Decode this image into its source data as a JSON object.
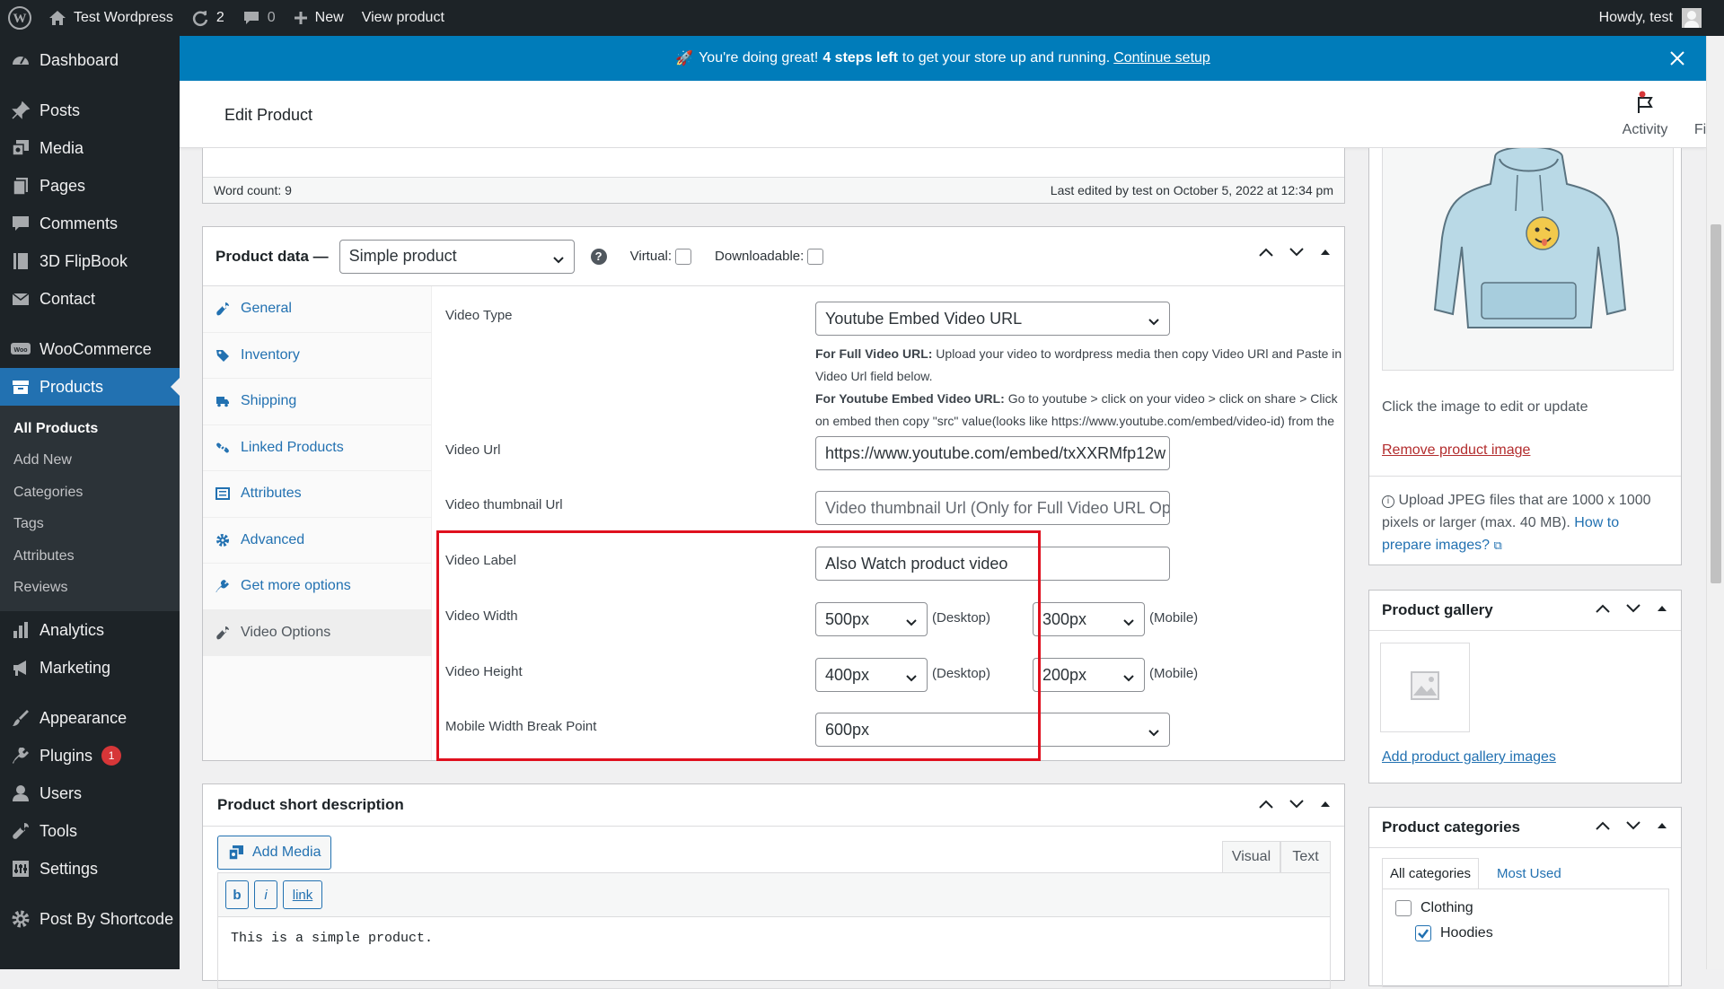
{
  "adminbar": {
    "site_name": "Test Wordpress",
    "updates_count": "2",
    "comments_count": "0",
    "new_label": "New",
    "view_product_label": "View product",
    "howdy": "Howdy, test"
  },
  "sidebar": {
    "items": [
      {
        "label": "Dashboard",
        "icon": "dashboard-icon"
      },
      {
        "label": "Posts",
        "icon": "pin-icon"
      },
      {
        "label": "Media",
        "icon": "media-icon"
      },
      {
        "label": "Pages",
        "icon": "page-icon"
      },
      {
        "label": "Comments",
        "icon": "comment-icon"
      },
      {
        "label": "3D FlipBook",
        "icon": "book-icon"
      },
      {
        "label": "Contact",
        "icon": "mail-icon"
      },
      {
        "label": "WooCommerce",
        "icon": "woo-icon"
      },
      {
        "label": "Products",
        "icon": "archive-icon"
      },
      {
        "label": "Analytics",
        "icon": "chart-icon"
      },
      {
        "label": "Marketing",
        "icon": "megaphone-icon"
      },
      {
        "label": "Appearance",
        "icon": "brush-icon"
      },
      {
        "label": "Plugins",
        "icon": "plug-icon"
      },
      {
        "label": "Users",
        "icon": "user-icon"
      },
      {
        "label": "Tools",
        "icon": "wrench-icon"
      },
      {
        "label": "Settings",
        "icon": "settings-icon"
      },
      {
        "label": "Post By Shortcode",
        "icon": "gear-icon"
      }
    ],
    "plugins_badge": "1",
    "submenu": [
      "All Products",
      "Add New",
      "Categories",
      "Tags",
      "Attributes",
      "Reviews"
    ]
  },
  "notice": {
    "text_before": "You're doing great!",
    "bold": "4 steps left",
    "text_after": "to get your store up and running.",
    "link": "Continue setup"
  },
  "header": {
    "title": "Edit Product",
    "activity_label": "Activity",
    "finish_setup_label": "Finish setup"
  },
  "editor": {
    "word_count": "Word count: 9",
    "last_edited": "Last edited by test on October 5, 2022 at 12:34 pm"
  },
  "product_data": {
    "title": "Product data —",
    "type_value": "Simple product",
    "virtual_label": "Virtual:",
    "downloadable_label": "Downloadable:",
    "tabs": [
      "General",
      "Inventory",
      "Shipping",
      "Linked Products",
      "Attributes",
      "Advanced",
      "Get more options",
      "Video Options"
    ],
    "fields": {
      "video_type_label": "Video Type",
      "video_type_value": "Youtube Embed Video URL",
      "hint1_bold": "For Full Video URL:",
      "hint1": "Upload your video to wordpress media then copy Video URl and Paste in Video Url field below.",
      "hint2_bold": "For Youtube Embed Video URL:",
      "hint2": "Go to youtube > click on your video > click on share > Click on embed then copy \"src\" value(looks like https://www.youtube.com/embed/video-id) from the code and Paste in Video Url field below.",
      "video_url_label": "Video Url",
      "video_url_value": "https://www.youtube.com/embed/txXXRMfp12w",
      "thumb_label": "Video thumbnail Url",
      "thumb_placeholder": "Video thumbnail Url (Only for Full Video URL Option)",
      "video_label_label": "Video Label",
      "video_label_value": "Also Watch product video",
      "width_label": "Video Width",
      "width_desktop": "500px",
      "width_mobile": "300px",
      "height_label": "Video Height",
      "height_desktop": "400px",
      "height_mobile": "200px",
      "desktop_suffix": "(Desktop)",
      "mobile_suffix": "(Mobile)",
      "breakpoint_label": "Mobile Width Break Point",
      "breakpoint_value": "600px"
    }
  },
  "short_description": {
    "title": "Product short description",
    "add_media": "Add Media",
    "tab_visual": "Visual",
    "tab_text": "Text",
    "qt_b": "b",
    "qt_i": "i",
    "qt_link": "link",
    "content": "This is a simple product."
  },
  "product_image": {
    "click_hint": "Click the image to edit or update",
    "remove_link": "Remove product image",
    "upload_info": "Upload JPEG files that are 1000 x 1000 pixels or larger (max. 40 MB).",
    "how_to_link": "How to prepare images?"
  },
  "product_gallery": {
    "title": "Product gallery",
    "add_link": "Add product gallery images"
  },
  "product_categories": {
    "title": "Product categories",
    "tab_all": "All categories",
    "tab_most_used": "Most Used",
    "items": [
      {
        "label": "Clothing",
        "checked": false
      },
      {
        "label": "Hoodies",
        "checked": true
      }
    ]
  },
  "colors": {
    "admin_dark": "#1d2327",
    "accent_blue": "#2271b1",
    "notice_blue": "#007cba",
    "highlight_red": "#e0101e"
  }
}
